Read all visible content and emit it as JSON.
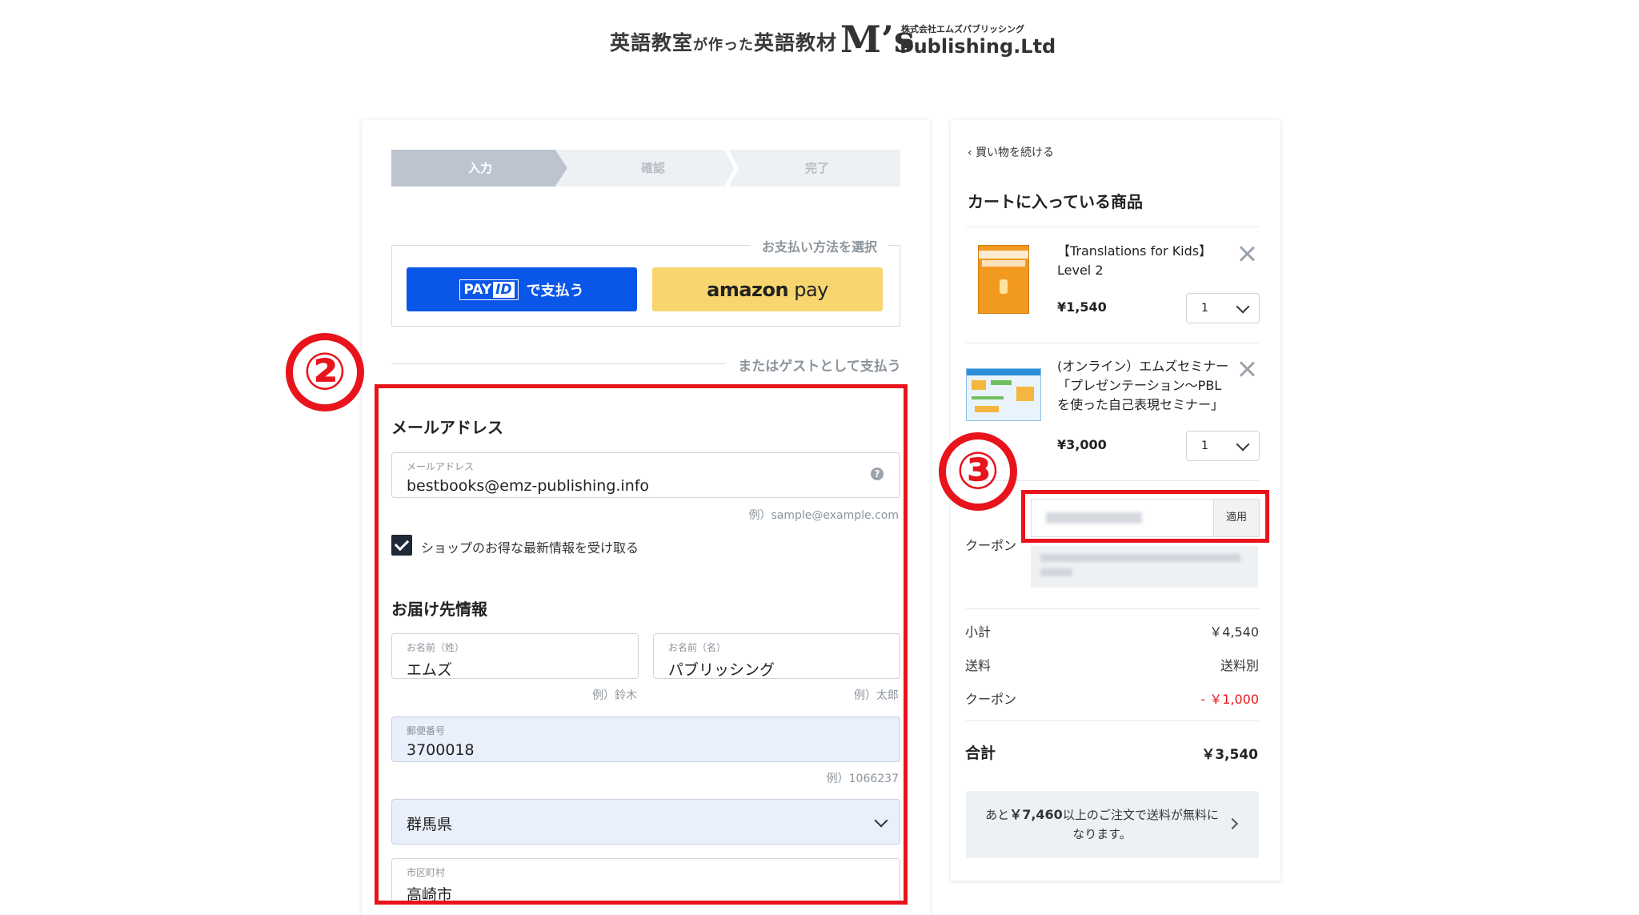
{
  "header": {
    "tagline_a": "英語教室",
    "tagline_b": "が作った",
    "tagline_c": "英語教材",
    "logo_mark": "M’s",
    "company_jp": "株式会社エムズパブリッシング",
    "company_en": "Publishing.Ltd"
  },
  "stepper": {
    "steps": [
      "入力",
      "確認",
      "完了"
    ],
    "active_index": 0
  },
  "payment": {
    "title": "お支払い方法を選択",
    "payid_logo_a": "PAY",
    "payid_logo_b": "ID",
    "payid_label": "で支払う",
    "amazon_a": "amazon",
    "amazon_b": " pay",
    "guest_divider": "またはゲストとして支払う"
  },
  "form": {
    "email_section": "メールアドレス",
    "email_label": "メールアドレス",
    "email_value": "bestbooks@emz-publishing.info",
    "email_hint": "例）sample@example.com",
    "newsletter_label": "ショップのお得な最新情報を受け取る",
    "newsletter_checked": true,
    "shipping_section": "お届け先情報",
    "last_name_label": "お名前（姓）",
    "last_name_value": "エムズ",
    "last_name_hint": "例）鈴木",
    "first_name_label": "お名前（名）",
    "first_name_value": "パブリッシング",
    "first_name_hint": "例）太郎",
    "zip_label": "郵便番号",
    "zip_value": "3700018",
    "zip_hint": "例）1066237",
    "prefecture_value": "群馬県",
    "city_label": "市区町村",
    "city_value": "高崎市"
  },
  "annotations": {
    "left_number": "②",
    "right_number": "③",
    "color": "#e8131b"
  },
  "cart": {
    "back_link": "買い物を続ける",
    "title": "カートに入っている商品",
    "items": [
      {
        "name_line1": "【Translations for Kids】",
        "name_line2": "Level 2",
        "name_line3": "",
        "price": "¥1,540",
        "qty": "1"
      },
      {
        "name_line1": "(オンライン）エムズセミナー",
        "name_line2": "「プレゼンテーション〜PBL",
        "name_line3": "を使った自己表現セミナー」",
        "price": "¥3,000",
        "qty": "1"
      }
    ],
    "coupon_label": "クーポン",
    "apply_label": "適用",
    "summary": {
      "subtotal_label": "小計",
      "subtotal_value": "￥4,540",
      "shipping_label": "送料",
      "shipping_value": "送料別",
      "coupon_label": "クーポン",
      "coupon_value": "- ￥1,000",
      "total_label": "合計",
      "total_value": "￥3,540"
    },
    "shipping_notice_a": "あと",
    "shipping_notice_amount": "￥7,460",
    "shipping_notice_b": "以上のご注文で送料が無料になります。"
  },
  "colors": {
    "payid_blue": "#0a56e8",
    "amazon_yellow": "#f8d56f",
    "discount_red": "#e8131b"
  }
}
